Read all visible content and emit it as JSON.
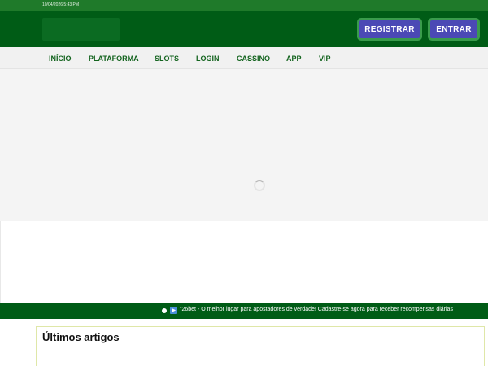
{
  "topbar": {
    "timestamp": "10/04/2026 5:43 PM"
  },
  "header": {
    "register_label": "REGISTRAR",
    "login_label": "ENTRAR",
    "button_color": "#4b49b5",
    "brand_color": "#005c16"
  },
  "nav": {
    "items": [
      {
        "label": "INÍCIO"
      },
      {
        "label": "PLATAFORMA"
      },
      {
        "label": "SLOTS"
      },
      {
        "label": "LOGIN"
      },
      {
        "label": "CASSINO"
      },
      {
        "label": "APP"
      },
      {
        "label": "VIP"
      }
    ]
  },
  "banner": {
    "loading_icon": "spinner-icon"
  },
  "ticker": {
    "icon": "speaker-icon",
    "text": "\"26bet - O melhor lugar para apostadores de verdade! Cadastre-se agora para receber recompensas diárias"
  },
  "articles": {
    "heading": "Últimos artigos"
  }
}
